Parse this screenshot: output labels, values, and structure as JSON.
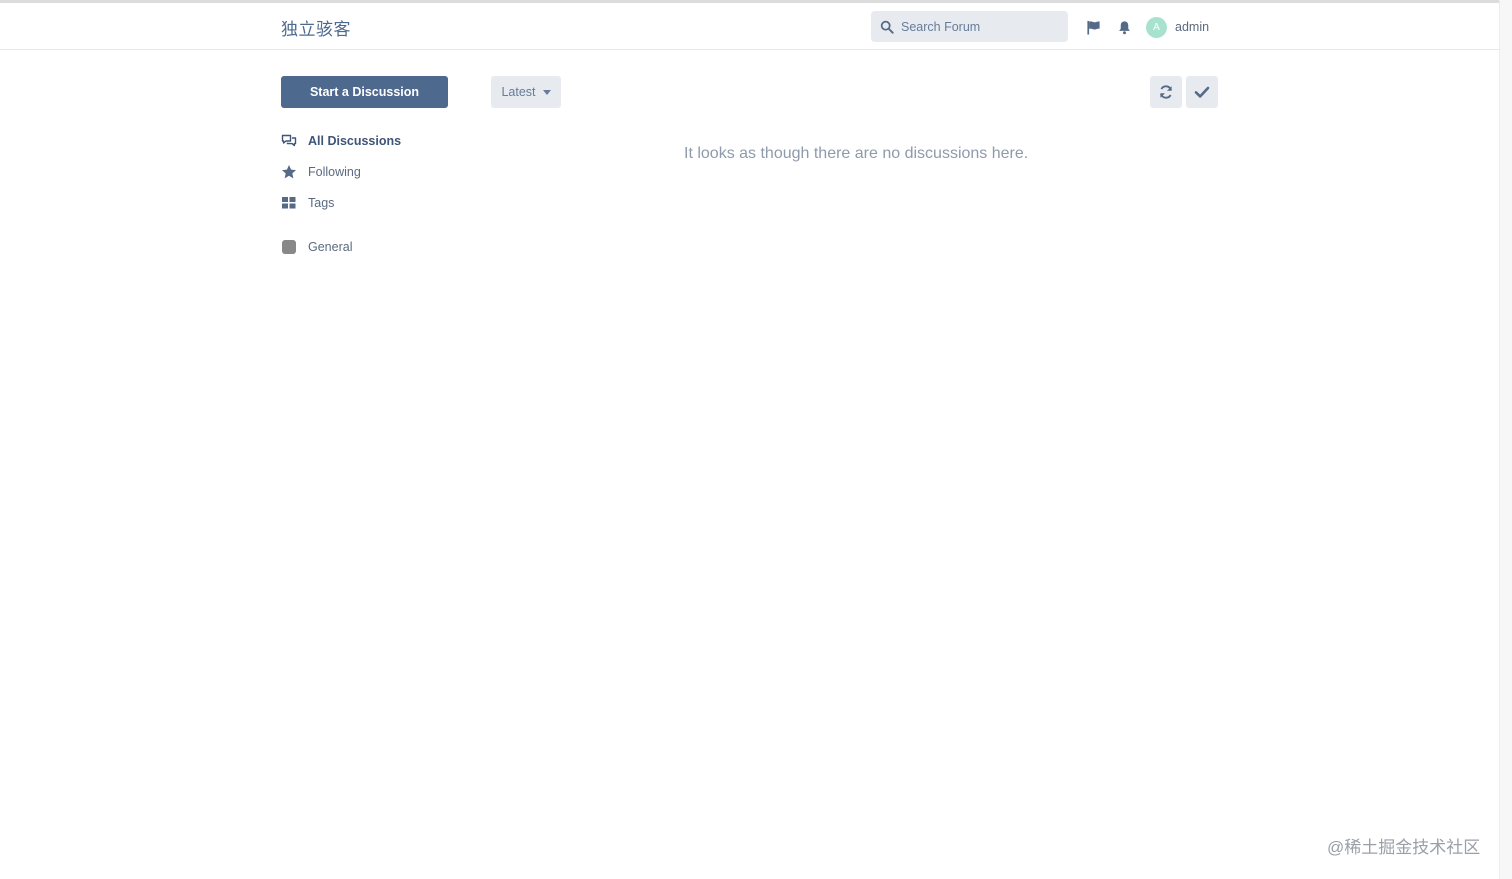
{
  "header": {
    "brand": "独立骇客",
    "search_placeholder": "Search Forum",
    "user": {
      "avatar_letter": "A",
      "name": "admin",
      "avatar_color": "#a7e2cf"
    }
  },
  "toolbar": {
    "start_label": "Start a Discussion",
    "sort_label": "Latest"
  },
  "nav": {
    "items": [
      {
        "label": "All Discussions",
        "icon": "comments-icon"
      },
      {
        "label": "Following",
        "icon": "star-icon"
      },
      {
        "label": "Tags",
        "icon": "grid-icon"
      }
    ],
    "tags": [
      {
        "label": "General",
        "color": "#888888"
      }
    ]
  },
  "main": {
    "empty_message": "It looks as though there are no discussions here."
  },
  "watermark": "@稀土掘金技术社区",
  "colors": {
    "primary": "#4d698e",
    "control_bg": "#e7ebf0"
  }
}
